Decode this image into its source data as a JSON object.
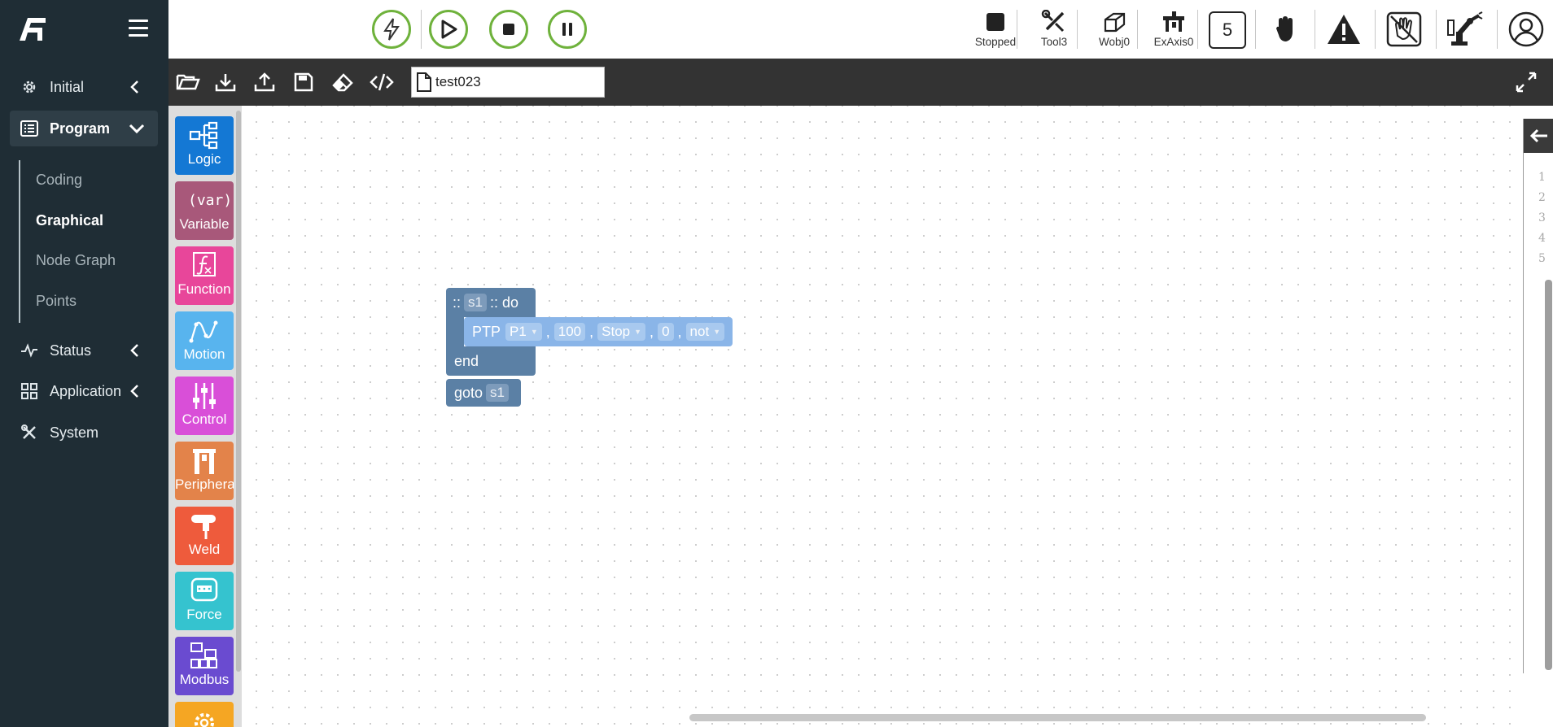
{
  "colors": {
    "sidebar_bg": "#1f2d35",
    "run_green": "#6fb23c",
    "toolbar_bg": "#333333",
    "block_blue": "#5b80a5",
    "ptp_blue": "#8ab5e8"
  },
  "sidebar": {
    "logo_icon": "brand-logo-icon",
    "menu_icon": "hamburger-icon",
    "items": [
      {
        "label": "Initial",
        "icon": "gear-icon"
      },
      {
        "label": "Program",
        "icon": "program-list-icon"
      },
      {
        "label": "Status",
        "icon": "pulse-icon"
      },
      {
        "label": "Application",
        "icon": "grid-icon"
      },
      {
        "label": "System",
        "icon": "tools-icon"
      }
    ],
    "program_sub": [
      {
        "label": "Coding"
      },
      {
        "label": "Graphical"
      },
      {
        "label": "Node Graph"
      },
      {
        "label": "Points"
      }
    ]
  },
  "topbar": {
    "run_buttons": [
      "power-bolt-icon",
      "play-icon",
      "stop-icon",
      "pause-icon"
    ],
    "status": [
      {
        "label": "Stopped",
        "icon": "stopped-square-icon"
      },
      {
        "label": "Tool3",
        "icon": "wrench-icon"
      },
      {
        "label": "Wobj0",
        "icon": "cube-icon"
      },
      {
        "label": "ExAxis0",
        "icon": "ext-axis-icon"
      }
    ],
    "speed_value": "5",
    "right_icons": [
      "hand-icon",
      "warning-icon",
      "hand-guard-icon",
      "robot-arm-icon",
      "user-icon"
    ]
  },
  "toolbar": {
    "buttons": [
      "open-folder-icon",
      "import-icon",
      "export-icon",
      "save-icon",
      "eraser-icon",
      "code-icon"
    ],
    "file_name": "test023",
    "expand_icon": "expand-icon"
  },
  "palette": [
    {
      "label": "Logic",
      "color": "#1478d4",
      "icon": "logic-tree-icon"
    },
    {
      "label": "Variable",
      "color": "#a8587a",
      "icon": "var-icon",
      "icon_text": "(var)"
    },
    {
      "label": "Function",
      "color": "#e8469a",
      "icon": "function-fx-icon"
    },
    {
      "label": "Motion",
      "color": "#58b4ee",
      "icon": "motion-curve-icon"
    },
    {
      "label": "Control",
      "color": "#d94fd8",
      "icon": "control-sliders-icon"
    },
    {
      "label": "Peripheral",
      "color": "#e3834a",
      "icon": "peripheral-gripper-icon"
    },
    {
      "label": "Weld",
      "color": "#ee5b3c",
      "icon": "weld-torch-icon"
    },
    {
      "label": "Force",
      "color": "#35c3cf",
      "icon": "force-sensor-icon"
    },
    {
      "label": "Modbus",
      "color": "#6a4bd0",
      "icon": "modbus-network-icon"
    },
    {
      "label": "",
      "color": "#f5a623",
      "icon": "settings-gear-icon"
    }
  ],
  "workspace": {
    "label_block": {
      "prefix": "::",
      "name": "s1",
      "suffix": ":: do"
    },
    "ptp_block": {
      "keyword": "PTP",
      "point": "P1",
      "speed": "100",
      "mode": "Stop",
      "value": "0",
      "flag": "not"
    },
    "end_label": "end",
    "goto_block": {
      "keyword": "goto",
      "target": "s1"
    }
  },
  "right_panel": {
    "toggle_icon": "arrow-left-icon",
    "line_numbers": [
      "1",
      "2",
      "3",
      "4",
      "5"
    ]
  }
}
